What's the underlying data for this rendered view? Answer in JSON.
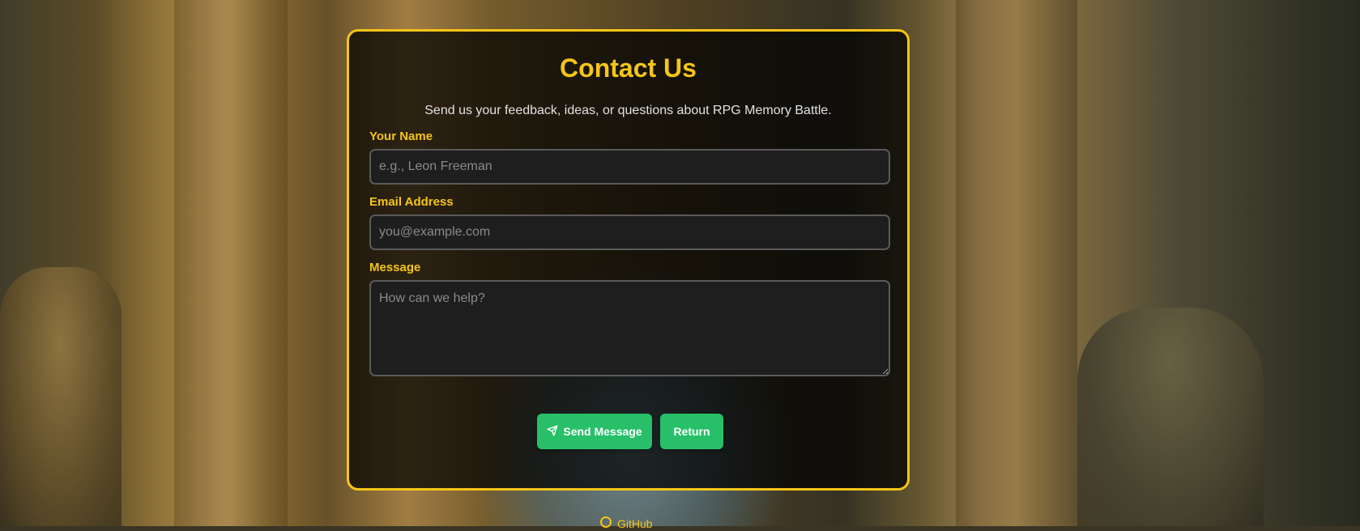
{
  "page": {
    "title": "Contact Us",
    "subtitle": "Send us your feedback, ideas, or questions about RPG Memory Battle."
  },
  "form": {
    "name": {
      "label": "Your Name",
      "placeholder": "e.g., Leon Freeman",
      "value": ""
    },
    "email": {
      "label": "Email Address",
      "placeholder": "you@example.com",
      "value": ""
    },
    "message": {
      "label": "Message",
      "placeholder": "How can we help?",
      "value": ""
    }
  },
  "actions": {
    "send_label": "Send Message",
    "send_icon": "paper-plane-icon",
    "return_label": "Return"
  },
  "footer": {
    "link_label": "GitHub",
    "link_icon": "github-icon"
  },
  "colors": {
    "accent": "#f5c518",
    "button": "#27c068",
    "card_bg": "rgba(0,0,0,0.72)",
    "field_bg": "#1e1e1e"
  }
}
